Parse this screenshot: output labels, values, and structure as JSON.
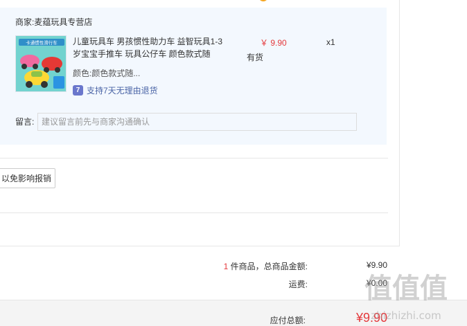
{
  "shop": {
    "label": "商家:",
    "name": "麦蕴玩具专营店"
  },
  "product": {
    "thumb_banner": "卡通惯性滑行车",
    "title": "儿童玩具车 男孩惯性助力车 益智玩具1-3岁宝宝手推车 玩具公仔车 颜色款式随",
    "attr_label": "颜色:",
    "attr_value": "颜色款式随...",
    "return_icon": "7",
    "return_text": "支持7天无理由退货",
    "price": "￥ 9.90",
    "stock": "有货",
    "qty": "x1"
  },
  "message": {
    "label": "留言:",
    "placeholder": "建议留言前先与商家沟通确认"
  },
  "invoice_button": "以免影响报销",
  "summary": {
    "count": "1",
    "count_suffix": " 件商品，总商品金额:",
    "amount": "¥9.90",
    "shipping_label": "运费:",
    "shipping": "¥0.00",
    "total_label": "应付总额:",
    "total": "¥9.90"
  },
  "watermark": {
    "text": "值值值",
    "url": "zhizhizhi.com"
  },
  "colors": {
    "accent_red": "#e4393c",
    "panel_bg": "#f3f8fe",
    "link_blue": "#4a64a6"
  }
}
